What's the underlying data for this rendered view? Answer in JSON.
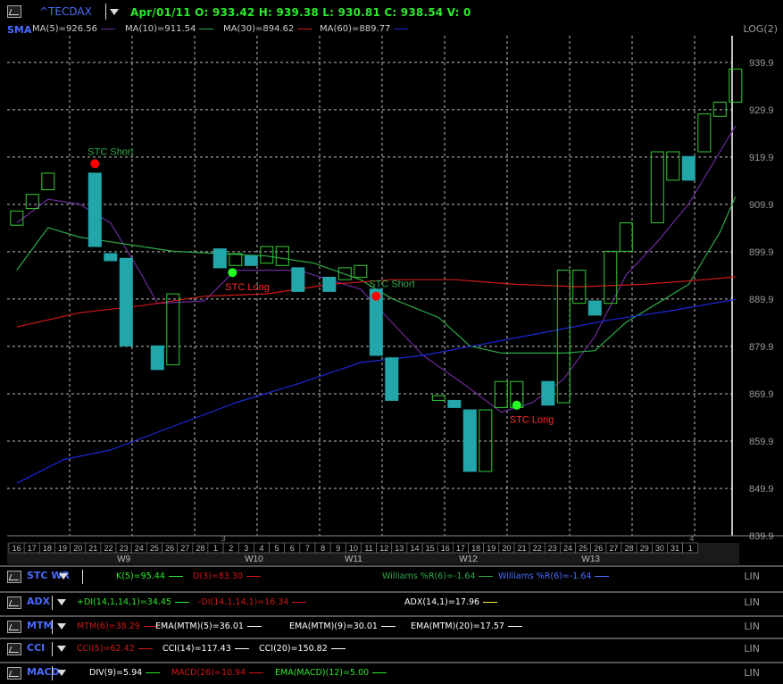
{
  "header": {
    "symbol": "^TECDAX",
    "ohlc": "Apr/01/11  O: 933.42   H: 939.38   L: 930.81   C: 938.54   V: 0",
    "study_label": "SMA",
    "ma_legend": [
      {
        "label": "MA(5)=926.56",
        "color": "#6b2a9a"
      },
      {
        "label": "MA(10)=911.54",
        "color": "#2ea84a"
      },
      {
        "label": "MA(30)=894.62",
        "color": "#d01818"
      },
      {
        "label": "MA(60)=889.77",
        "color": "#1a2ad8"
      }
    ],
    "scale_mode": "LOG(2)"
  },
  "chart_data": {
    "type": "candlestick",
    "y_ticks": [
      "939.9",
      "929.9",
      "919.9",
      "909.9",
      "899.9",
      "889.9",
      "879.9",
      "869.9",
      "859.9",
      "849.9",
      "839.9"
    ],
    "ylim": [
      839.9,
      941
    ],
    "day_labels": [
      "16",
      "17",
      "18",
      "19",
      "20",
      "21",
      "22",
      "23",
      "24",
      "25",
      "26",
      "27",
      "28",
      "1",
      "2",
      "3",
      "4",
      "5",
      "6",
      "7",
      "8",
      "9",
      "10",
      "11",
      "12",
      "13",
      "14",
      "15",
      "16",
      "17",
      "18",
      "19",
      "20",
      "21",
      "22",
      "23",
      "24",
      "25",
      "26",
      "27",
      "28",
      "29",
      "30",
      "31",
      "1"
    ],
    "week_labels": [
      {
        "label": "W9",
        "at": 7.5
      },
      {
        "label": "W10",
        "at": 16
      },
      {
        "label": "W11",
        "at": 22.5
      },
      {
        "label": "W12",
        "at": 30
      },
      {
        "label": "W13",
        "at": 38
      }
    ],
    "small_labels": [
      {
        "label": "3",
        "at": 14
      },
      {
        "label": "4",
        "at": 44.6
      }
    ],
    "candles": [
      {
        "i": 0,
        "o": 905.5,
        "c": 908.5
      },
      {
        "i": 1,
        "o": 909,
        "c": 912
      },
      {
        "i": 2,
        "o": 913,
        "c": 916.5
      },
      {
        "i": 5,
        "o": 916.5,
        "c": 901
      },
      {
        "i": 6,
        "o": 899.5,
        "c": 898
      },
      {
        "i": 7,
        "o": 898.5,
        "c": 880
      },
      {
        "i": 9,
        "o": 880,
        "c": 875
      },
      {
        "i": 10,
        "o": 876,
        "c": 891
      },
      {
        "i": 13,
        "o": 900.5,
        "c": 896.5
      },
      {
        "i": 14,
        "o": 897,
        "c": 899.5
      },
      {
        "i": 15,
        "o": 899,
        "c": 897
      },
      {
        "i": 16,
        "o": 897.5,
        "c": 901
      },
      {
        "i": 17,
        "o": 897,
        "c": 901
      },
      {
        "i": 18,
        "o": 896.5,
        "c": 891.5
      },
      {
        "i": 20,
        "o": 894.5,
        "c": 891.5
      },
      {
        "i": 21,
        "o": 894,
        "c": 896.5
      },
      {
        "i": 22,
        "o": 894.5,
        "c": 897
      },
      {
        "i": 23,
        "o": 892,
        "c": 878
      },
      {
        "i": 24,
        "o": 877.5,
        "c": 868.5
      },
      {
        "i": 27,
        "o": 868.5,
        "c": 869.5
      },
      {
        "i": 28,
        "o": 868.5,
        "c": 867
      },
      {
        "i": 29,
        "o": 866.5,
        "c": 853.5
      },
      {
        "i": 30,
        "o": 853.5,
        "c": 866.5
      },
      {
        "i": 31,
        "o": 867,
        "c": 872.5
      },
      {
        "i": 32,
        "o": 867,
        "c": 872.5
      },
      {
        "i": 34,
        "o": 872.5,
        "c": 867.5
      },
      {
        "i": 35,
        "o": 868,
        "c": 896
      },
      {
        "i": 36,
        "o": 889,
        "c": 896
      },
      {
        "i": 37,
        "o": 889.5,
        "c": 886.5
      },
      {
        "i": 38,
        "o": 889,
        "c": 900
      },
      {
        "i": 39,
        "o": 900,
        "c": 906
      },
      {
        "i": 41,
        "o": 906,
        "c": 921
      },
      {
        "i": 42,
        "o": 915,
        "c": 921
      },
      {
        "i": 43,
        "o": 920,
        "c": 915
      },
      {
        "i": 44,
        "o": 921,
        "c": 929
      },
      {
        "i": 45,
        "o": 928.5,
        "c": 931.5
      },
      {
        "i": 46,
        "o": 931.5,
        "c": 938.5
      }
    ],
    "ma_series": [
      {
        "name": "MA(5)",
        "color": "#6b2a9a",
        "points": [
          [
            0,
            906
          ],
          [
            2,
            911
          ],
          [
            4,
            910
          ],
          [
            6,
            906
          ],
          [
            8,
            895
          ],
          [
            9,
            889
          ],
          [
            12,
            889.5
          ],
          [
            14,
            896
          ],
          [
            18,
            896
          ],
          [
            20,
            894
          ],
          [
            22,
            892
          ],
          [
            24,
            885
          ],
          [
            26,
            878
          ],
          [
            29,
            871
          ],
          [
            31,
            866
          ],
          [
            33,
            868
          ],
          [
            35,
            873
          ],
          [
            37,
            882
          ],
          [
            39,
            895
          ],
          [
            41,
            902
          ],
          [
            43,
            910
          ],
          [
            45,
            921
          ],
          [
            46,
            926.5
          ]
        ]
      },
      {
        "name": "MA(10)",
        "color": "#2ea84a",
        "points": [
          [
            0,
            896
          ],
          [
            2,
            905
          ],
          [
            4,
            903
          ],
          [
            6,
            902
          ],
          [
            8,
            901
          ],
          [
            10,
            900
          ],
          [
            13,
            899.5
          ],
          [
            16,
            899
          ],
          [
            19,
            897.5
          ],
          [
            22,
            894
          ],
          [
            24,
            890
          ],
          [
            27,
            886
          ],
          [
            29,
            880
          ],
          [
            31,
            878.5
          ],
          [
            33,
            878.5
          ],
          [
            35,
            878.5
          ],
          [
            37,
            879
          ],
          [
            39,
            885
          ],
          [
            41,
            889
          ],
          [
            43,
            893
          ],
          [
            45,
            904
          ],
          [
            46,
            911.5
          ]
        ]
      },
      {
        "name": "MA(30)",
        "color": "#d01818",
        "points": [
          [
            0,
            884
          ],
          [
            4,
            887
          ],
          [
            8,
            888.5
          ],
          [
            12,
            890.5
          ],
          [
            16,
            891
          ],
          [
            20,
            893
          ],
          [
            24,
            894
          ],
          [
            28,
            894
          ],
          [
            32,
            893
          ],
          [
            36,
            892.5
          ],
          [
            40,
            893
          ],
          [
            44,
            894
          ],
          [
            46,
            894.6
          ]
        ]
      },
      {
        "name": "MA(60)",
        "color": "#1a2ad8",
        "points": [
          [
            0,
            851
          ],
          [
            3,
            856
          ],
          [
            6,
            858
          ],
          [
            10,
            863
          ],
          [
            14,
            868
          ],
          [
            18,
            872
          ],
          [
            22,
            876.5
          ],
          [
            26,
            878
          ],
          [
            30,
            880.5
          ],
          [
            34,
            883
          ],
          [
            38,
            885.5
          ],
          [
            42,
            887.5
          ],
          [
            46,
            889.8
          ]
        ]
      }
    ],
    "signals": [
      {
        "i": 5,
        "y": 918.5,
        "type": "short",
        "label": "STC Short"
      },
      {
        "i": 13.8,
        "y": 895.5,
        "type": "long",
        "label": "STC Long"
      },
      {
        "i": 23,
        "y": 890.5,
        "type": "short",
        "label": "STC Short"
      },
      {
        "i": 32,
        "y": 867.5,
        "type": "long",
        "label": "STC Long"
      }
    ]
  },
  "panels": [
    {
      "name": "STC WR",
      "items": [
        {
          "text": "K(5)=95.44",
          "color": "#2ee82e",
          "line": "#2ee82e",
          "x": 130
        },
        {
          "text": "D(3)=83.30",
          "color": "#d01818",
          "line": "#d01818",
          "x": 216
        },
        {
          "text": "Williams %R(6)=-1.64",
          "color": "#2ea84a",
          "line": "#2ea84a",
          "x": 428
        },
        {
          "text": "Williams %R(6)=-1.64",
          "color": "#4a6cff",
          "line": "#4a6cff",
          "x": 558
        }
      ]
    },
    {
      "name": "ADX",
      "items": [
        {
          "text": "+DI(14,1,14,1)=34.45",
          "color": "#2ee82e",
          "line": "#2ee82e",
          "x": 86
        },
        {
          "text": "-DI(14,1,14,1)=16.34",
          "color": "#d01818",
          "line": "#d01818",
          "x": 222
        },
        {
          "text": "ADX(14,1)=17.96",
          "color": "#ffffff",
          "line": "#ffee33",
          "x": 453
        }
      ]
    },
    {
      "name": "MTM",
      "items": [
        {
          "text": "MTM(6)=38.29",
          "color": "#d01818",
          "line": "#d01818",
          "x": 86
        },
        {
          "text": "EMA(MTM)(5)=36.01",
          "color": "#ffffff",
          "line": "#ffffff",
          "x": 174
        },
        {
          "text": "EMA(MTM)(9)=30.01",
          "color": "#ffffff",
          "line": "#ffffff",
          "x": 324
        },
        {
          "text": "EMA(MTM)(20)=17.57",
          "color": "#ffffff",
          "line": "#ffffff",
          "x": 460
        }
      ]
    },
    {
      "name": "CCI",
      "items": [
        {
          "text": "CCI(5)=62.42",
          "color": "#d01818",
          "line": "#d01818",
          "x": 86
        },
        {
          "text": "CCI(14)=117.43",
          "color": "#ffffff",
          "line": "#ffffff",
          "x": 182
        },
        {
          "text": "CCI(20)=150.82",
          "color": "#ffffff",
          "line": "#ffffff",
          "x": 290
        }
      ]
    },
    {
      "name": "MACD",
      "items": [
        {
          "text": "DIV(9)=5.94",
          "color": "#ffffff",
          "line": "#2ee82e",
          "x": 100
        },
        {
          "text": "MACD(26)=10.94",
          "color": "#d01818",
          "line": "#d01818",
          "x": 192
        },
        {
          "text": "EMA(MACD)(12)=5.00",
          "color": "#2ee82e",
          "line": "#2ee82e",
          "x": 308
        }
      ]
    }
  ],
  "panel_scale": "LIN",
  "colors": {
    "up_candle": "#33cc33",
    "down_candle": "#22a6aa",
    "grid": "#bdbdbd",
    "signal_short": "#ff0000",
    "signal_long": "#22ff22",
    "short_label": "#2ea84a",
    "long_label": "#ff2a2a"
  }
}
